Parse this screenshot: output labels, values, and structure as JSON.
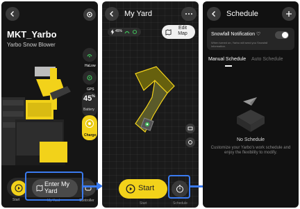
{
  "colors": {
    "accent": "#f2d21a",
    "highlight": "#3a7bf0",
    "panel_dark": "#151515",
    "green": "#3fbf5a"
  },
  "screen1": {
    "title": "MKT_Yarbo",
    "subtitle": "Yarbo Snow Blower",
    "side_items": [
      {
        "label": "HaLow",
        "icon": "signal-icon"
      },
      {
        "label": "GPS",
        "icon": "gps-icon"
      }
    ],
    "battery": {
      "value": "45",
      "unit": "%",
      "label": "Battery"
    },
    "charge_label": "Charge",
    "enter_button": "Enter My Yard",
    "bottom_labels": {
      "start": "Start",
      "my_yard": "My Yard",
      "controller": "Controller"
    }
  },
  "screen2": {
    "title": "My Yard",
    "status": {
      "battery": "45%"
    },
    "edit_map": "Edit Map",
    "start_button": "Start",
    "bottom_labels": {
      "start": "Start",
      "schedule": "Schedule"
    }
  },
  "screen3": {
    "title": "Schedule",
    "snowfall": {
      "title": "Snowfall Notification",
      "desc": "When turned on, Yarbo will send you Snowfall information.",
      "enabled": true
    },
    "tabs": [
      "Manual Schedule",
      "Auto Schedule"
    ],
    "active_tab": 0,
    "empty_title": "No Schedule",
    "empty_desc": "Customize your Yarbo's work schedule and enjoy the flexibility to modify."
  }
}
